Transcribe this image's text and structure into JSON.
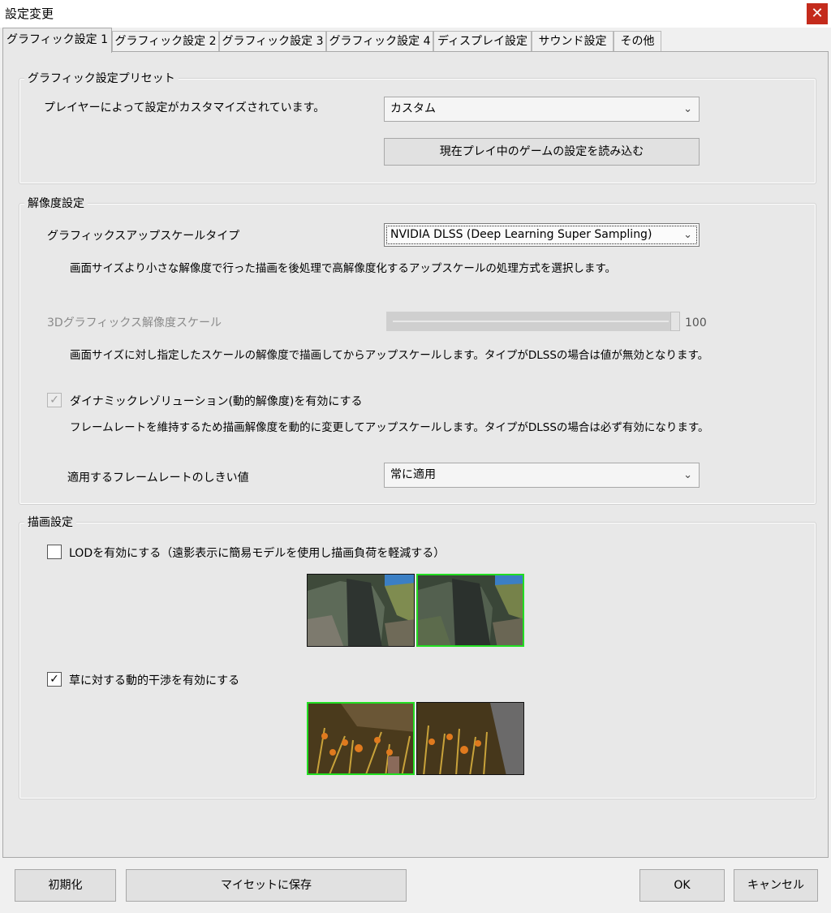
{
  "window": {
    "title": "設定変更",
    "close_glyph": "✕"
  },
  "tabs": [
    {
      "label": "グラフィック設定 1",
      "active": true
    },
    {
      "label": "グラフィック設定 2"
    },
    {
      "label": "グラフィック設定 3"
    },
    {
      "label": "グラフィック設定 4"
    },
    {
      "label": "ディスプレイ設定"
    },
    {
      "label": "サウンド設定"
    },
    {
      "label": "その他"
    }
  ],
  "preset": {
    "title": "グラフィック設定プリセット",
    "status": "プレイヤーによって設定がカスタマイズされています。",
    "combo_value": "カスタム",
    "load_button": "現在プレイ中のゲームの設定を読み込む"
  },
  "resolution": {
    "title": "解像度設定",
    "upscale_label": "グラフィックスアップスケールタイプ",
    "upscale_value": "NVIDIA DLSS (Deep Learning Super Sampling)",
    "upscale_desc": "画面サイズより小さな解像度で行った描画を後処理で高解像度化するアップスケールの処理方式を選択します。",
    "scale_label": "3Dグラフィックス解像度スケール",
    "scale_value": "100",
    "scale_fraction": 1.0,
    "scale_desc": "画面サイズに対し指定したスケールの解像度で描画してからアップスケールします。タイプがDLSSの場合は値が無効となります。",
    "dynamic_label": "ダイナミックレゾリューション(動的解像度)を有効にする",
    "dynamic_checked": true,
    "dynamic_desc": "フレームレートを維持するため描画解像度を動的に変更してアップスケールします。タイプがDLSSの場合は必ず有効になります。",
    "threshold_label": "適用するフレームレートのしきい値",
    "threshold_value": "常に適用"
  },
  "render": {
    "title": "描画設定",
    "lod_label": "LODを有効にする（遠影表示に簡易モデルを使用し描画負荷を軽減する）",
    "lod_checked": false,
    "grass_label": "草に対する動的干渉を有効にする",
    "grass_checked": true
  },
  "footer": {
    "reset": "初期化",
    "save": "マイセットに保存",
    "ok": "OK",
    "cancel": "キャンセル"
  },
  "icons": {
    "chevron": "chevron-down-icon",
    "check": "checkmark-icon"
  },
  "colors": {
    "highlight": "#22dd22",
    "close": "#c42b1c"
  }
}
